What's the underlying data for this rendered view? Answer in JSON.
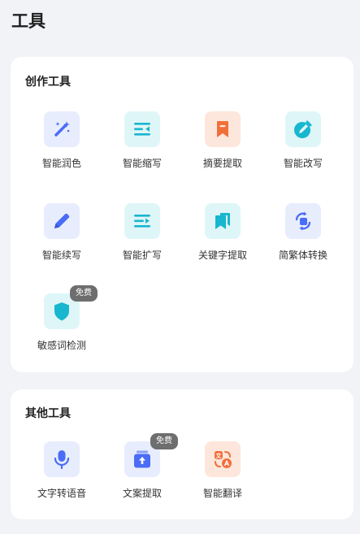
{
  "page_title": "工具",
  "sections": [
    {
      "title": "创作工具",
      "tools": [
        {
          "label": "智能润色",
          "icon": "magic-wand-icon"
        },
        {
          "label": "智能缩写",
          "icon": "condense-lines-icon"
        },
        {
          "label": "摘要提取",
          "icon": "bookmark-icon"
        },
        {
          "label": "智能改写",
          "icon": "edit-circle-icon"
        },
        {
          "label": "智能续写",
          "icon": "pencil-icon"
        },
        {
          "label": "智能扩写",
          "icon": "expand-lines-icon"
        },
        {
          "label": "关键字提取",
          "icon": "bookmarks-icon"
        },
        {
          "label": "简繁体转换",
          "icon": "convert-icon"
        },
        {
          "label": "敏感词检测",
          "icon": "shield-icon",
          "badge": "免费"
        }
      ]
    },
    {
      "title": "其他工具",
      "tools": [
        {
          "label": "文字转语音",
          "icon": "microphone-icon"
        },
        {
          "label": "文案提取",
          "icon": "upload-folder-icon",
          "badge": "免费"
        },
        {
          "label": "智能翻译",
          "icon": "translate-icon"
        }
      ]
    }
  ],
  "colors": {
    "blue": "#4a6cf7",
    "cyan": "#19b6cf",
    "orange": "#f0703a"
  }
}
